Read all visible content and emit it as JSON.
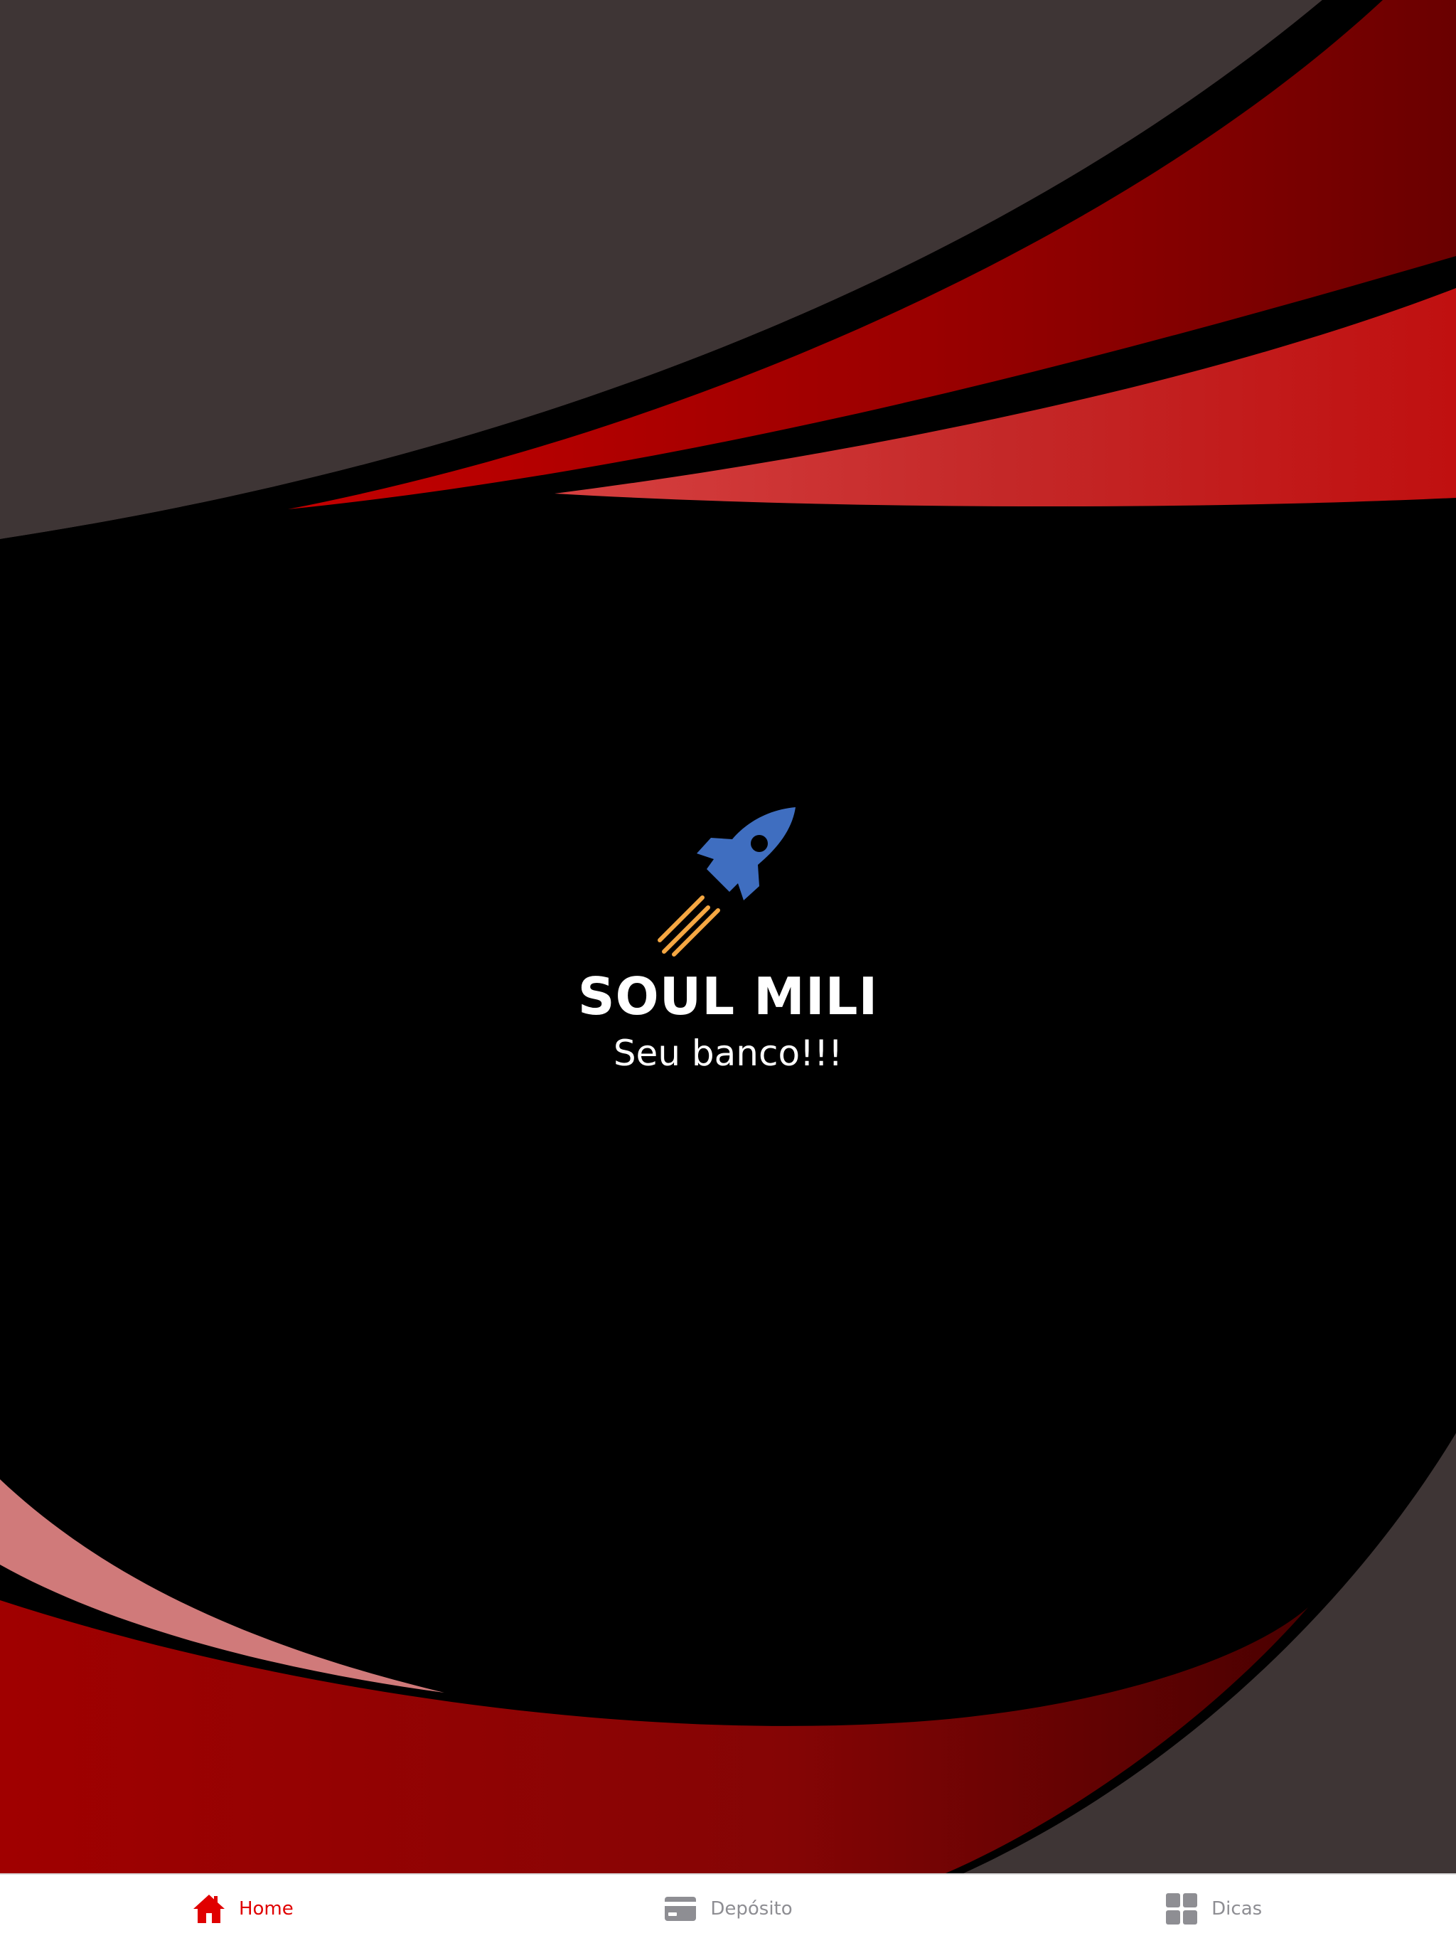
{
  "app": {
    "name": "SOUL MILI",
    "tagline": "Seu banco!!!"
  },
  "icons": {
    "logo": "rocket-icon",
    "home": "home-icon",
    "deposit": "credit-card-icon",
    "tips": "grid-icon"
  },
  "colors": {
    "background": "#000000",
    "red_primary": "#b00000",
    "red_light": "#d07a7a",
    "gray_dark": "#3e3535",
    "rocket_blue": "#3f6ec0",
    "rocket_flame": "#f5a742",
    "tab_active": "#e00000",
    "tab_inactive": "#8e8e93"
  },
  "tabbar": {
    "tabs": [
      {
        "label": "Home",
        "active": true
      },
      {
        "label": "Depósito",
        "active": false
      },
      {
        "label": "Dicas",
        "active": false
      }
    ]
  }
}
